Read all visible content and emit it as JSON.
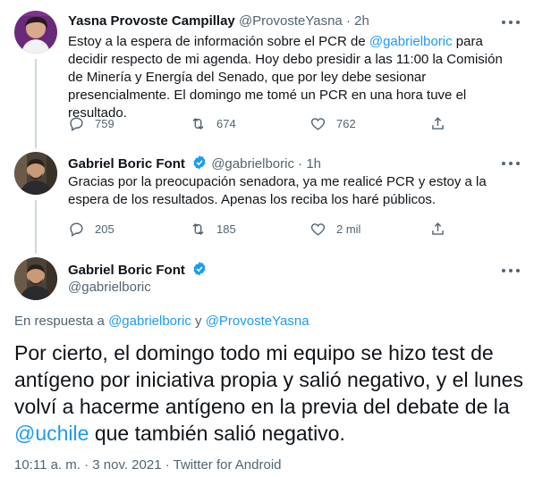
{
  "tweets": [
    {
      "name": "Yasna Provoste Campillay",
      "handle": "@ProvosteYasna",
      "time": "2h",
      "text_before": "Estoy a la espera de información sobre el PCR de ",
      "mention": "@gabrielboric",
      "text_after": " para decidir respecto de mi agenda. Hoy debo presidir a las 11:00 la Comisión de Minería y Energía del Senado, que por ley debe sesionar presencialmente. El domingo me tomé un PCR en una hora tuve el resultado.",
      "replies": "759",
      "retweets": "674",
      "likes": "762"
    },
    {
      "name": "Gabriel Boric Font",
      "handle": "@gabrielboric",
      "time": "1h",
      "text": "Gracias por la preocupación senadora, ya me realicé PCR y estoy a la espera de los resultados. Apenas los reciba los haré públicos.",
      "replies": "205",
      "retweets": "185",
      "likes": "2 mil"
    }
  ],
  "main_tweet": {
    "name": "Gabriel Boric Font",
    "handle": "@gabrielboric",
    "reply_prefix": "En respuesta a ",
    "reply_user1": "@gabrielboric",
    "reply_joiner": " y ",
    "reply_user2": "@ProvosteYasna",
    "text_before": "Por cierto, el domingo todo mi equipo se hizo test de antígeno por iniciativa propia y salió negativo, y el lunes volví a hacerme antígeno en la previa del debate de la ",
    "mention": "@uchile",
    "text_after": " que también salió negativo.",
    "meta": "10:11 a. m. · 3 nov. 2021 · Twitter for Android"
  },
  "dot": "·",
  "colors": {
    "link": "#1d9bf0",
    "muted": "#536471",
    "verified": "#1d9bf0",
    "thread_line": "#cfd9de"
  }
}
